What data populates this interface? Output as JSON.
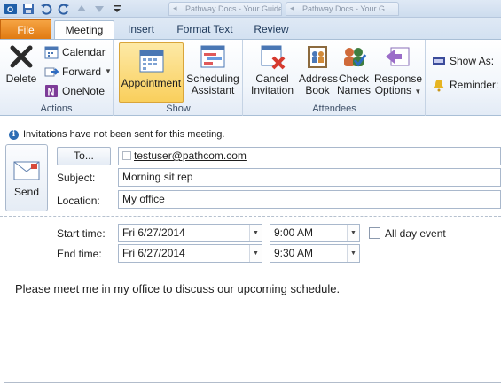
{
  "window": {
    "title_tabs": [
      "Pathway Docs - Your Guide to...",
      "Pathway Docs - Your G..."
    ]
  },
  "ribbon_tabs": {
    "file": "File",
    "meeting": "Meeting",
    "insert": "Insert",
    "format_text": "Format Text",
    "review": "Review"
  },
  "actions": {
    "delete": "Delete",
    "calendar": "Calendar",
    "forward": "Forward",
    "onenote": "OneNote",
    "label": "Actions"
  },
  "show": {
    "appointment": "Appointment",
    "scheduling_line1": "Scheduling",
    "scheduling_line2": "Assistant",
    "label": "Show"
  },
  "attendees": {
    "cancel_line1": "Cancel",
    "cancel_line2": "Invitation",
    "address_line1": "Address",
    "address_line2": "Book",
    "check_line1": "Check",
    "check_line2": "Names",
    "response_line1": "Response",
    "response_line2": "Options",
    "label": "Attendees"
  },
  "options": {
    "show_as": "Show As:",
    "reminder": "Reminder:"
  },
  "infobar": {
    "message": "Invitations have not been sent for this meeting."
  },
  "form": {
    "send_label": "Send",
    "to_button": "To...",
    "to_value": "testuser@pathcom.com",
    "subject_label": "Subject:",
    "subject_value": "Morning sit rep",
    "location_label": "Location:",
    "location_value": "My office",
    "start_label": "Start time:",
    "start_date": "Fri 6/27/2014",
    "start_time": "9:00 AM",
    "end_label": "End time:",
    "end_date": "Fri 6/27/2014",
    "end_time": "9:30 AM",
    "all_day_label": "All day event"
  },
  "body": {
    "text": "Please meet me in my office to discuss our upcoming schedule."
  },
  "colors": {
    "file_tab": "#e07a12",
    "selected_button": "#f9cf5c",
    "info_icon": "#2e6db4"
  }
}
